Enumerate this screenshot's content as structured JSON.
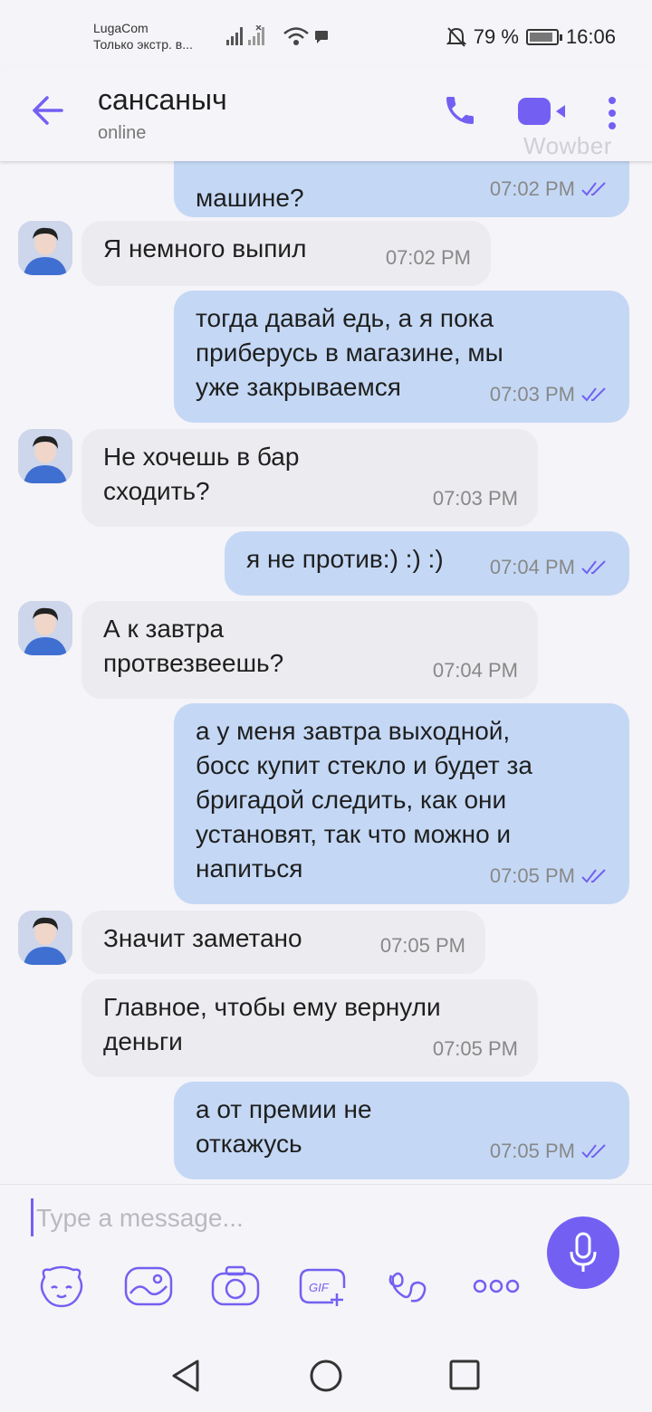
{
  "status_bar": {
    "carrier": "LugaCom",
    "carrier_sub": "Только экстр. в...",
    "battery_percent": "79 %",
    "battery_level": 0.79,
    "time": "16:06"
  },
  "header": {
    "contact_name": "сансаныч",
    "contact_status": "online",
    "brand": "Wowber",
    "icons": [
      "back-arrow-icon",
      "phone-icon",
      "video-camera-icon",
      "more-vert-icon"
    ]
  },
  "messages": [
    {
      "dir": "out",
      "text": "машине?",
      "time": "07:02 PM",
      "read": true
    },
    {
      "dir": "in",
      "text": "Я немного выпил",
      "time": "07:02 PM",
      "avatar": true
    },
    {
      "dir": "out",
      "text": "тогда давай едь, а я пока\nприберусь в магазине, мы\nуже закрываемся",
      "time": "07:03 PM",
      "read": true
    },
    {
      "dir": "in",
      "text": "Не хочешь в бар\nсходить?",
      "time": "07:03 PM",
      "avatar": true
    },
    {
      "dir": "out",
      "text": "я не против:) :) :)",
      "time": "07:04 PM",
      "read": true
    },
    {
      "dir": "in",
      "text": "А к завтра\nпротвезвеешь?",
      "time": "07:04 PM",
      "avatar": true
    },
    {
      "dir": "out",
      "text": "а у меня завтра выходной,\nбосс купит стекло и будет за\nбригадой следить,  как они\nустановят, так что можно и\nнапиться",
      "time": "07:05 PM",
      "read": true
    },
    {
      "dir": "in",
      "text": "Значит заметано",
      "time": "07:05 PM",
      "avatar": true
    },
    {
      "dir": "in",
      "text": "Главное, чтобы ему вернули\nденьги",
      "time": "07:05 PM",
      "avatar": false
    },
    {
      "dir": "out",
      "text": "а от премии не\nоткажусь",
      "time": "07:05 PM",
      "read": true
    }
  ],
  "composer": {
    "placeholder": "Type a message...",
    "tools": [
      "sticker-icon",
      "image-icon",
      "camera-icon",
      "gif-icon",
      "doodle-icon",
      "more-horiz-icon"
    ],
    "mic": "microphone-icon"
  },
  "nav_bar": {
    "buttons": [
      "back-triangle-icon",
      "home-circle-icon",
      "recents-square-icon"
    ]
  },
  "colors": {
    "accent": "#7360f2",
    "outgoing_bubble": "#c4d8f5",
    "incoming_bubble": "#ececf0",
    "background": "#f5f4f8"
  }
}
